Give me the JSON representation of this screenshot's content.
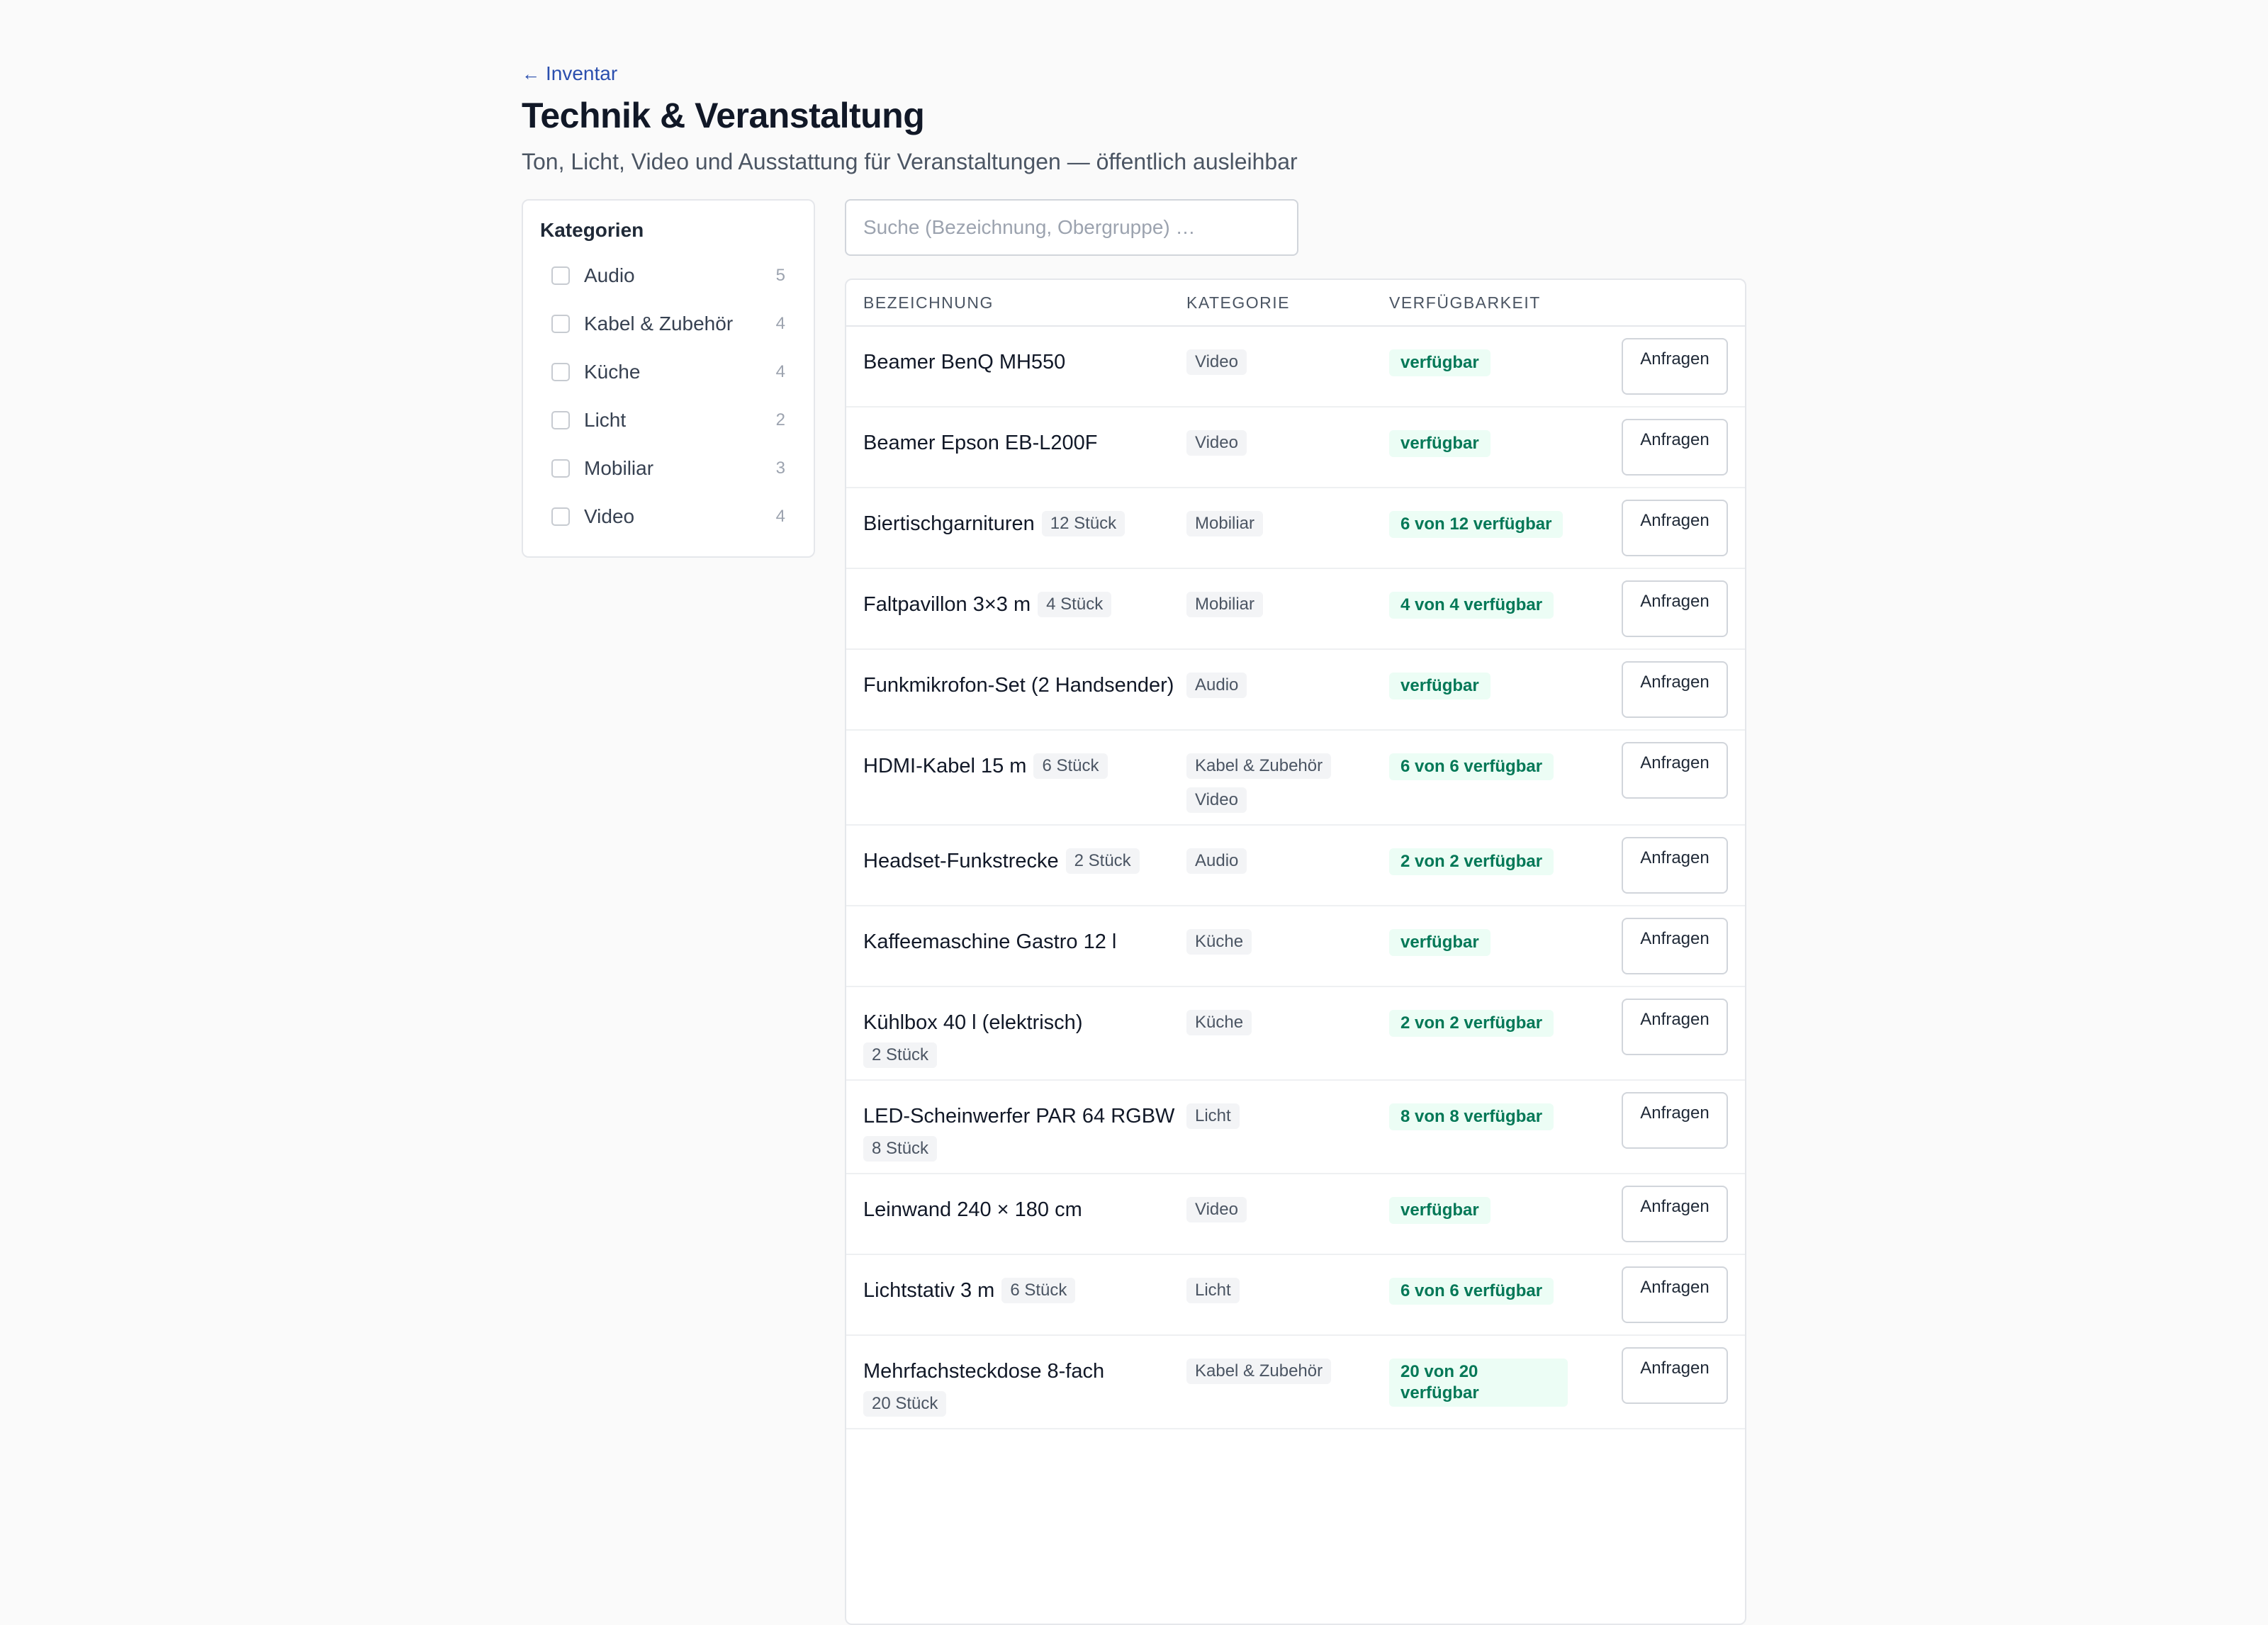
{
  "header": {
    "back_label": "Inventar",
    "title": "Technik & Veranstaltung",
    "subtitle": "Ton, Licht, Video und Ausstattung für Veranstaltungen — öffentlich ausleihbar"
  },
  "sidebar": {
    "title": "Kategorien",
    "items": [
      {
        "label": "Audio",
        "count": "5"
      },
      {
        "label": "Kabel & Zubehör",
        "count": "4"
      },
      {
        "label": "Küche",
        "count": "4"
      },
      {
        "label": "Licht",
        "count": "2"
      },
      {
        "label": "Mobiliar",
        "count": "3"
      },
      {
        "label": "Video",
        "count": "4"
      }
    ]
  },
  "search": {
    "placeholder": "Suche (Bezeichnung, Obergruppe) …",
    "value": ""
  },
  "table": {
    "headers": {
      "name": "Bezeichnung",
      "category": "Kategorie",
      "availability": "Verfügbarkeit"
    },
    "action_label": "Anfragen",
    "rows": [
      {
        "name": "Beamer BenQ MH550",
        "qty": "",
        "categories": [
          "Video"
        ],
        "availability": "verfügbar"
      },
      {
        "name": "Beamer Epson EB-L200F",
        "qty": "",
        "categories": [
          "Video"
        ],
        "availability": "verfügbar"
      },
      {
        "name": "Biertischgarnituren",
        "qty": "12 Stück",
        "categories": [
          "Mobiliar"
        ],
        "availability": "6 von 12 verfügbar"
      },
      {
        "name": "Faltpavillon 3×3 m",
        "qty": "4 Stück",
        "categories": [
          "Mobiliar"
        ],
        "availability": "4 von 4 verfügbar"
      },
      {
        "name": "Funkmikrofon-Set (2 Handsender)",
        "qty": "",
        "categories": [
          "Audio"
        ],
        "availability": "verfügbar"
      },
      {
        "name": "HDMI-Kabel 15 m",
        "qty": "6 Stück",
        "categories": [
          "Kabel & Zubehör",
          "Video"
        ],
        "availability": "6 von 6 verfügbar"
      },
      {
        "name": "Headset-Funkstrecke",
        "qty": "2 Stück",
        "categories": [
          "Audio"
        ],
        "availability": "2 von 2 verfügbar"
      },
      {
        "name": "Kaffeemaschine Gastro 12 l",
        "qty": "",
        "categories": [
          "Küche"
        ],
        "availability": "verfügbar"
      },
      {
        "name": "Kühlbox 40 l (elektrisch)",
        "qty": "2 Stück",
        "categories": [
          "Küche"
        ],
        "availability": "2 von 2 verfügbar"
      },
      {
        "name": "LED-Scheinwerfer PAR 64 RGBW",
        "qty": "8 Stück",
        "categories": [
          "Licht"
        ],
        "availability": "8 von 8 verfügbar"
      },
      {
        "name": "Leinwand 240 × 180 cm",
        "qty": "",
        "categories": [
          "Video"
        ],
        "availability": "verfügbar"
      },
      {
        "name": "Lichtstativ 3 m",
        "qty": "6 Stück",
        "categories": [
          "Licht"
        ],
        "availability": "6 von 6 verfügbar"
      },
      {
        "name": "Mehrfachsteckdose 8-fach",
        "qty": "20 Stück",
        "categories": [
          "Kabel & Zubehör"
        ],
        "availability": "20 von 20 verfügbar"
      }
    ]
  },
  "colors": {
    "link": "#2b4fae",
    "available_text": "#047857",
    "available_bg": "#ecfdf5",
    "page_bg": "#fafafa"
  }
}
